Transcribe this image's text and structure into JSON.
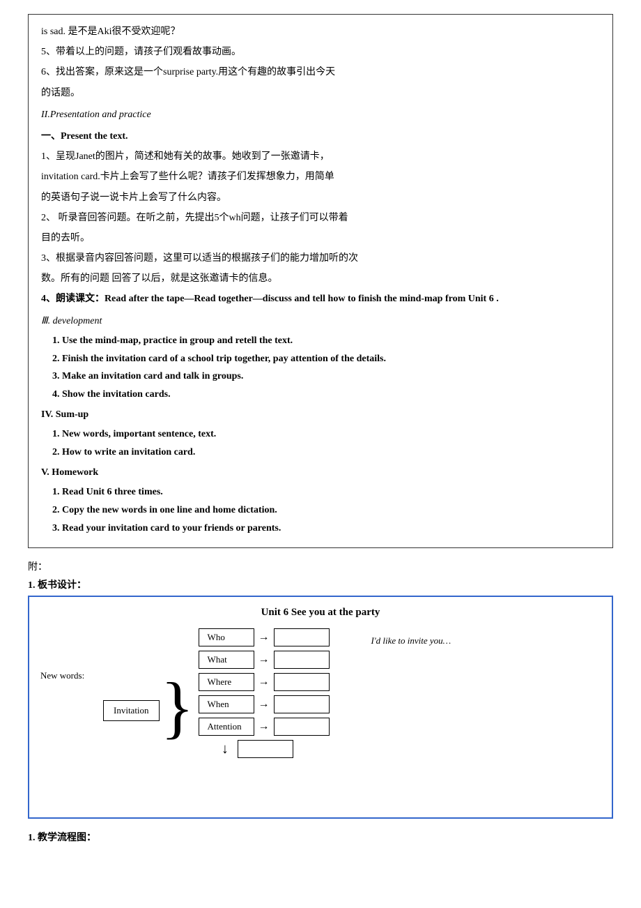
{
  "content": {
    "lines": [
      {
        "text": "is sad.  是不是Aki很不受欢迎呢？",
        "type": "normal"
      },
      {
        "text": "5、带着以上的问题，请孩子们观看故事动画。",
        "type": "normal"
      },
      {
        "text": "6、找出答案，原来这是一个surprise party.用这个有趣的故事引出今天",
        "type": "normal"
      },
      {
        "text": "的话题。",
        "type": "normal"
      },
      {
        "text": "II.Presentation and practice",
        "type": "section"
      },
      {
        "text": "一、Present the text.",
        "type": "chinese-bold"
      },
      {
        "text": "1、呈现Janet的图片，简述和她有关的故事。她收到了一张邀请卡，",
        "type": "normal"
      },
      {
        "text": "invitation card.卡片上会写了些什么呢？请孩子们发挥想象力，用简单",
        "type": "normal"
      },
      {
        "text": "的英语句子说一说卡片上会写了什么内容。",
        "type": "normal"
      },
      {
        "text": "2、 听录音回答问题。在听之前，先提出5个wh问题，让孩子们可以带着",
        "type": "normal"
      },
      {
        "text": "目的去听。",
        "type": "normal"
      },
      {
        "text": "3、根据录音内容回答问题，这里可以适当的根据孩子们的能力增加听的次",
        "type": "normal"
      },
      {
        "text": "数。所有的问题 回答了以后，就是这张邀请卡的信息。",
        "type": "normal"
      },
      {
        "text": "4、朗读课文：Read after the tape—Read together—discuss and tell how to finish the mind-map from Unit 6 .",
        "type": "bold"
      },
      {
        "text": "Ⅲ. development",
        "type": "section"
      },
      {
        "text": "1.  Use the mind-map, practice in group and retell the text.",
        "type": "list-bold"
      },
      {
        "text": "2.  Finish the invitation card of a school trip together, pay attention of the details.",
        "type": "list-bold"
      },
      {
        "text": "3.  Make an invitation card and talk in groups.",
        "type": "list-bold"
      },
      {
        "text": "4.  Show the invitation cards.",
        "type": "list-bold"
      },
      {
        "text": "IV. Sum-up",
        "type": "bold-heading"
      },
      {
        "text": "1.  New words, important sentence, text.",
        "type": "list-bold"
      },
      {
        "text": "2.  How to write an invitation card.",
        "type": "list-bold"
      },
      {
        "text": "V. Homework",
        "type": "bold-heading"
      },
      {
        "text": "1.  Read Unit 6 three times.",
        "type": "list-bold"
      },
      {
        "text": "2.  Copy the new words in one line and home dictation.",
        "type": "list-bold"
      },
      {
        "text": "3.  Read your invitation card to your friends or parents.",
        "type": "list-bold"
      }
    ],
    "footnote": "附：",
    "board_label": "1. 板书设计：",
    "board_title": "Unit 6 See you at the party",
    "new_words_label": "New words:",
    "invitation_label": "Invitation",
    "wh_items": [
      {
        "label": "Who"
      },
      {
        "label": "What"
      },
      {
        "label": "Where"
      },
      {
        "label": "When"
      },
      {
        "label": "Attention"
      }
    ],
    "right_text": "I'd like to invite you…",
    "last_label": "1. 教学流程图："
  }
}
